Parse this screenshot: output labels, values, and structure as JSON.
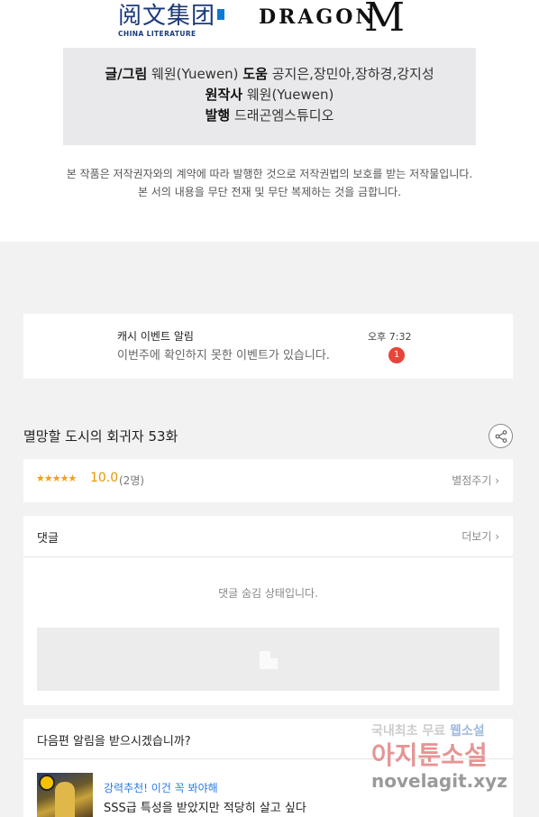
{
  "header": {
    "logo_left_zh": "阅文集团",
    "logo_left_en": "CHINA LITERATURE",
    "logo_right_text": "DRAGON",
    "logo_right_mark": "M"
  },
  "credits": {
    "line1_label1": "글/그림",
    "line1_value1": "웨원(Yuewen)",
    "line1_label2": "도움",
    "line1_value2": "공지은,장민아,장하경,강지성",
    "line2_label": "원작사",
    "line2_value": "웨원(Yuewen)",
    "line3_label": "발행",
    "line3_value": "드래곤엠스튜디오"
  },
  "notice": {
    "line1": "본 작품은 저작권자와의 계약에 따라 발행한 것으로 저작권법의 보호를 받는 저작물입니다.",
    "line2": "본 서의 내용을 무단 전재 및 무단 복제하는 것을 금합니다."
  },
  "alert": {
    "title": "캐시 이벤트 알림",
    "message": "이번주에 확인하지 못한 이벤트가 있습니다.",
    "time": "오후 7:32",
    "badge_count": "1"
  },
  "episode": {
    "title": "멸망할 도시의 회귀자 53화",
    "stars": "★★★★★",
    "score": "10.0",
    "raters": "(2명)",
    "rate_link": "별점주기 ›"
  },
  "comments": {
    "title": "댓글",
    "more": "더보기 ›",
    "hidden_msg": "댓글 숨김 상태입니다."
  },
  "subscribe": {
    "question": "다음편 알림을 받으시겠습니까?",
    "rec_tag": "강력추천! 이건 꼭 봐야해",
    "rec_title": "SSS급 특성을 받았지만 적당히 살고 싶다"
  },
  "watermark": {
    "line1_a": "국내최초 무료",
    "line1_b": "웹소설",
    "line2": "아지툰소설",
    "line3": "novelagit.xyz"
  },
  "colors": {
    "accent_star": "#f0a30a",
    "badge": "#e8443a",
    "link_blue": "#2a7ae2"
  }
}
